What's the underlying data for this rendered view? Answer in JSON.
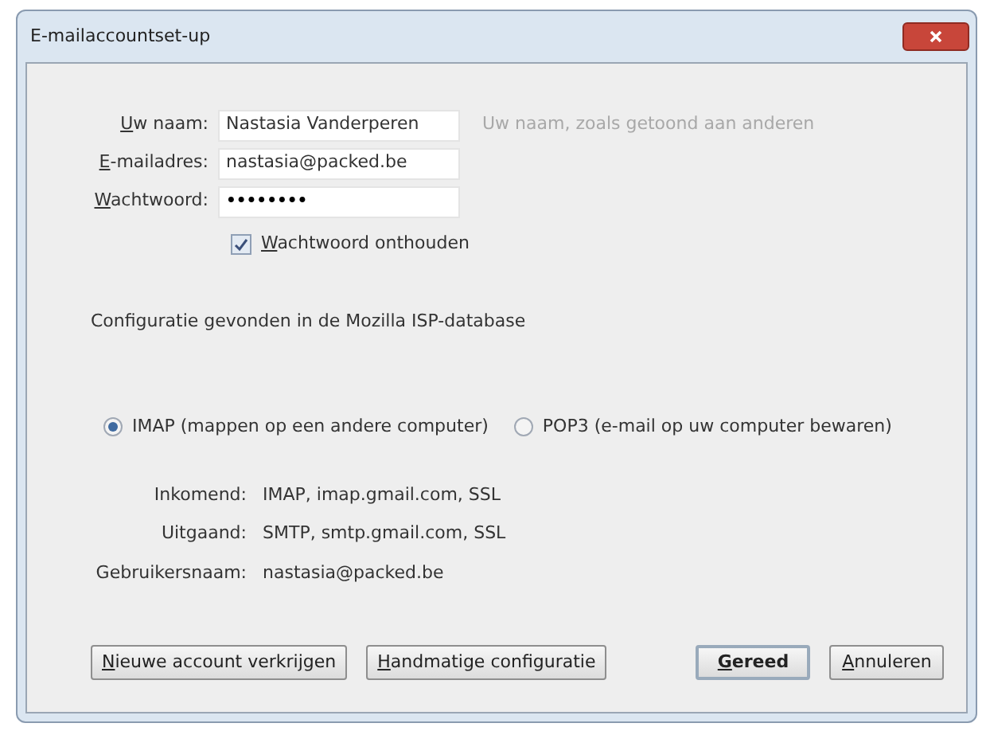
{
  "window": {
    "title": "E-mailaccountset-up"
  },
  "fields": [
    {
      "label": "Uw naam:",
      "value": "Nastasia Vanderperen",
      "hint": "Uw naam, zoals getoond aan anderen"
    },
    {
      "label": "E-mailadres:",
      "value": "nastasia@packed.be"
    },
    {
      "label": "Wachtwoord:",
      "value": "••••••••"
    }
  ],
  "remember_password": {
    "label": "Wachtwoord onthouden",
    "checked": true
  },
  "status": "Configuratie gevonden in de Mozilla ISP-database",
  "protocols": [
    {
      "label": "IMAP (mappen op een andere computer)",
      "selected": true
    },
    {
      "label": "POP3 (e-mail op uw computer bewaren)",
      "selected": false
    }
  ],
  "details": [
    {
      "label": "Inkomend:",
      "value": "IMAP, imap.gmail.com, SSL"
    },
    {
      "label": "Uitgaand:",
      "value": "SMTP, smtp.gmail.com, SSL"
    },
    {
      "label": "Gebruikersnaam:",
      "value": "nastasia@packed.be"
    }
  ],
  "buttons": [
    {
      "label": "Nieuwe account verkrijgen",
      "default": false
    },
    {
      "label": "Handmatige configuratie",
      "default": false
    },
    {
      "label": "Gereed",
      "default": true
    },
    {
      "label": "Annuleren",
      "default": false
    }
  ]
}
